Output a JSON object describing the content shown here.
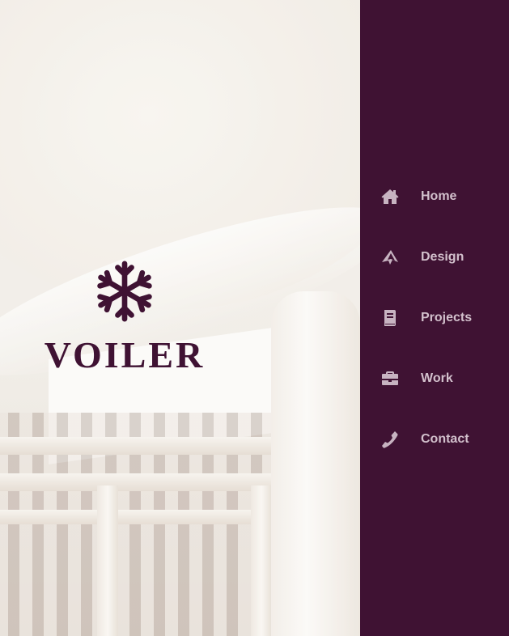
{
  "brand": {
    "name": "VOILER",
    "icon": "snowflake-icon",
    "color": "#3f1233"
  },
  "sidebar": {
    "background": "#3f1233",
    "items": [
      {
        "label": "Home",
        "icon": "home-icon"
      },
      {
        "label": "Design",
        "icon": "paper-plane-icon"
      },
      {
        "label": "Projects",
        "icon": "book-icon"
      },
      {
        "label": "Work",
        "icon": "briefcase-icon"
      },
      {
        "label": "Contact",
        "icon": "phone-icon"
      }
    ]
  },
  "hero": {
    "image": "architecture-background"
  }
}
